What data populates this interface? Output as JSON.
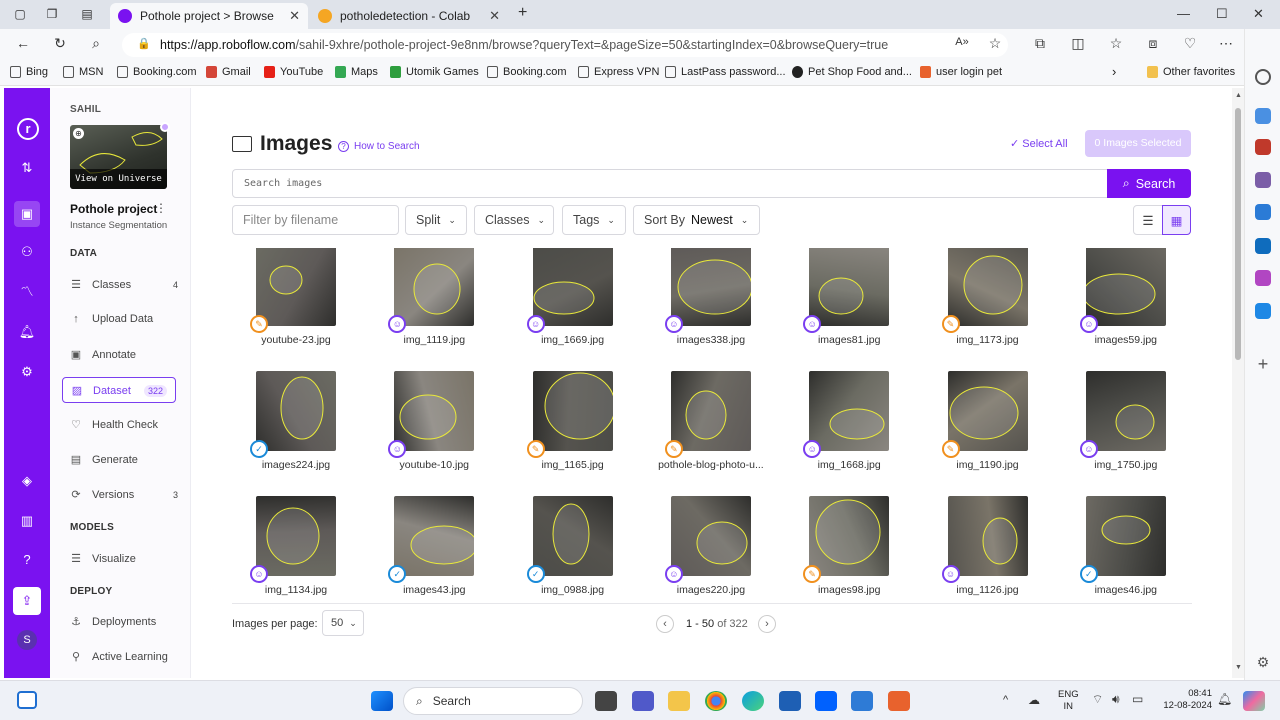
{
  "browser": {
    "tabs": [
      {
        "title": "Pothole project > Browse",
        "active": true
      },
      {
        "title": "potholedetection - Colab",
        "active": false
      }
    ],
    "url_host": "https://app.roboflow.com",
    "url_path": "/sahil-9xhre/pothole-project-9e8nm/browse?queryText=&pageSize=50&startingIndex=0&browseQuery=true",
    "bookmarks": [
      "Bing",
      "MSN",
      "Booking.com",
      "Gmail",
      "YouTube",
      "Maps",
      "Utomik Games",
      "Booking.com",
      "Express VPN",
      "LastPass password...",
      "Pet Shop Food and...",
      "user login pet"
    ],
    "other_favorites": "Other favorites"
  },
  "sidebar": {
    "workspace": "SAHIL",
    "universe_label": "View on Universe",
    "project_name": "Pothole project",
    "project_type": "Instance Segmentation",
    "data_heading": "DATA",
    "items": [
      {
        "label": "Classes",
        "count": "4",
        "icon": "list-icon"
      },
      {
        "label": "Upload Data",
        "count": "",
        "icon": "upload-icon"
      },
      {
        "label": "Annotate",
        "count": "",
        "icon": "annotate-icon"
      },
      {
        "label": "Dataset",
        "count": "322",
        "icon": "dataset-icon",
        "active": true
      },
      {
        "label": "Health Check",
        "count": "",
        "icon": "heart-icon"
      },
      {
        "label": "Generate",
        "count": "",
        "icon": "generate-icon"
      },
      {
        "label": "Versions",
        "count": "3",
        "icon": "versions-icon"
      }
    ],
    "models_heading": "MODELS",
    "models_items": [
      {
        "label": "Visualize"
      }
    ],
    "deploy_heading": "DEPLOY",
    "deploy_items": [
      {
        "label": "Deployments"
      },
      {
        "label": "Active Learning"
      }
    ],
    "avatar_letter": "S"
  },
  "main": {
    "title": "Images",
    "how_to_search": "How to Search",
    "select_all": "Select All",
    "selected_count": "0 Images Selected",
    "search_placeholder": "Search images",
    "search_button": "Search",
    "filter_placeholder": "Filter by filename",
    "split_label": "Split",
    "classes_label": "Classes",
    "tags_label": "Tags",
    "sort_label": "Sort By",
    "sort_value": "Newest",
    "images": [
      {
        "name": "youtube-23.jpg",
        "badge": "edit"
      },
      {
        "name": "img_1119.jpg",
        "badge": "person"
      },
      {
        "name": "img_1669.jpg",
        "badge": "person"
      },
      {
        "name": "images338.jpg",
        "badge": "person"
      },
      {
        "name": "images81.jpg",
        "badge": "person"
      },
      {
        "name": "img_1173.jpg",
        "badge": "edit"
      },
      {
        "name": "images59.jpg",
        "badge": "person"
      },
      {
        "name": "images224.jpg",
        "badge": "shield"
      },
      {
        "name": "youtube-10.jpg",
        "badge": "person"
      },
      {
        "name": "img_1165.jpg",
        "badge": "edit"
      },
      {
        "name": "pothole-blog-photo-u...",
        "badge": "edit"
      },
      {
        "name": "img_1668.jpg",
        "badge": "person"
      },
      {
        "name": "img_1190.jpg",
        "badge": "edit"
      },
      {
        "name": "img_1750.jpg",
        "badge": "person"
      },
      {
        "name": "img_1134.jpg",
        "badge": "person"
      },
      {
        "name": "images43.jpg",
        "badge": "shield"
      },
      {
        "name": "img_0988.jpg",
        "badge": "shield"
      },
      {
        "name": "images220.jpg",
        "badge": "person"
      },
      {
        "name": "images98.jpg",
        "badge": "edit"
      },
      {
        "name": "img_1126.jpg",
        "badge": "person"
      },
      {
        "name": "images46.jpg",
        "badge": "shield"
      }
    ],
    "per_page_label": "Images per page:",
    "per_page_value": "50",
    "range": "1 - 50",
    "range_of": "of 322"
  },
  "taskbar": {
    "search_label": "Search",
    "lang1": "ENG",
    "lang2": "IN",
    "time": "08:41",
    "date": "12-08-2024"
  },
  "colors": {
    "brand": "#7a12f0",
    "accent": "#7a3ef0",
    "edit_badge": "#f0901e",
    "shield_badge": "#1a8ad8",
    "selected_bg": "#d9c8fb"
  }
}
